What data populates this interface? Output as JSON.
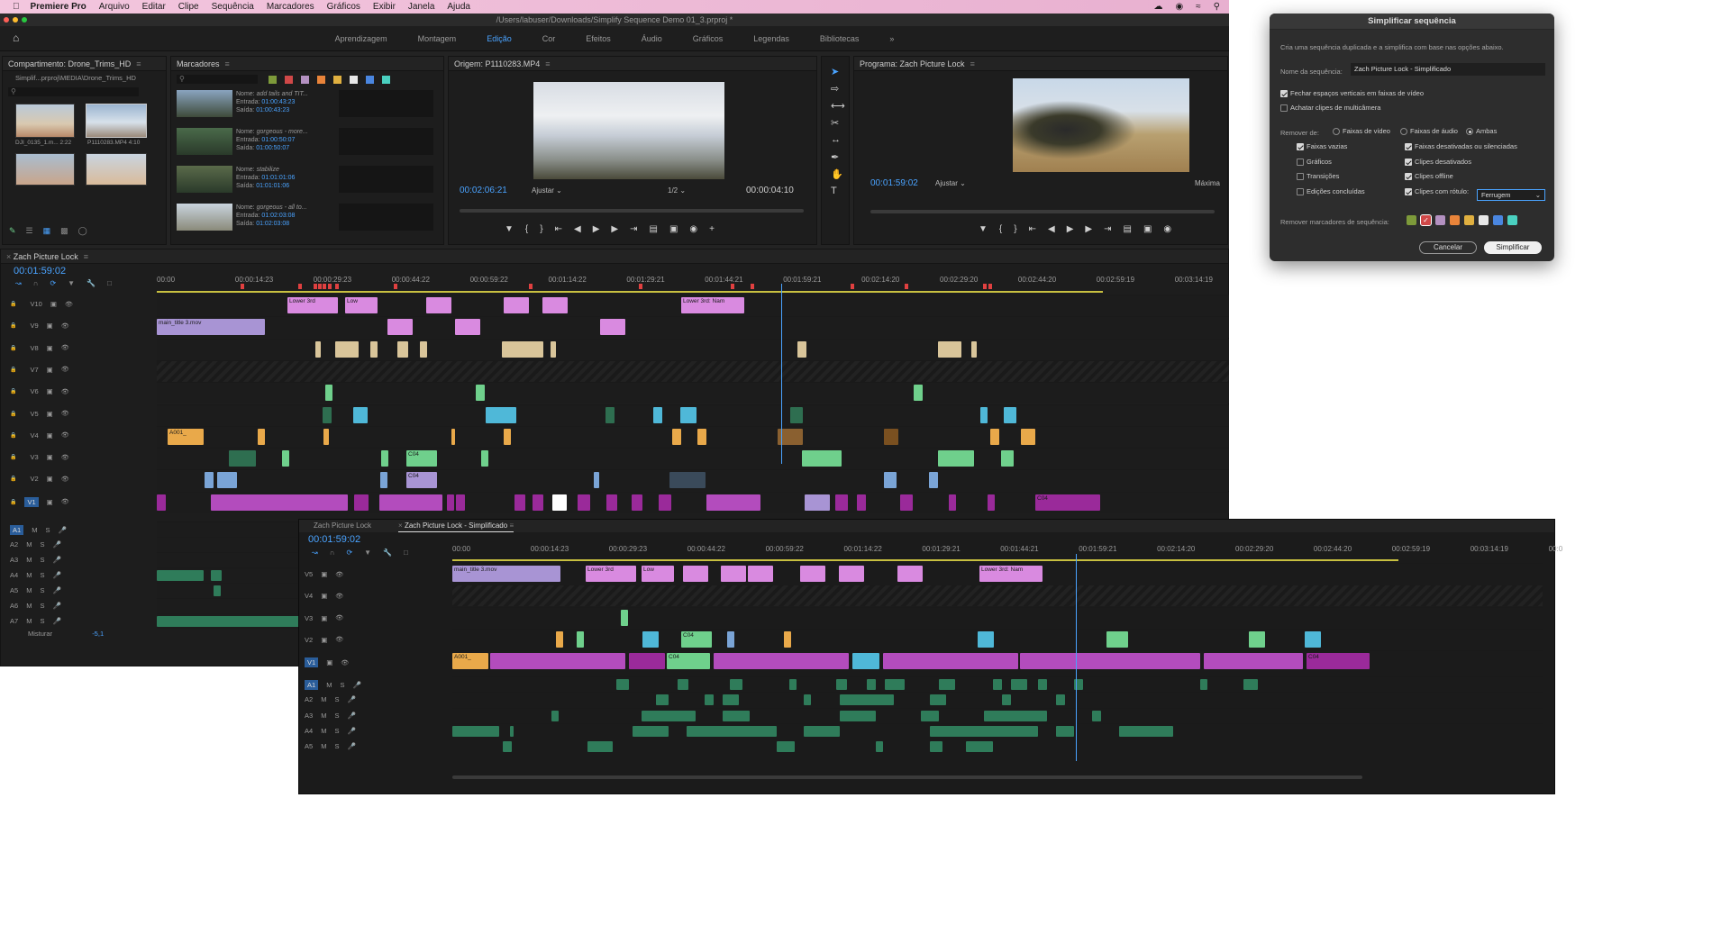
{
  "menubar": {
    "app": "Premiere Pro",
    "items": [
      "Arquivo",
      "Editar",
      "Clipe",
      "Sequência",
      "Marcadores",
      "Gráficos",
      "Exibir",
      "Janela",
      "Ajuda"
    ]
  },
  "window": {
    "title": "/Users/labuser/Downloads/Simplify Sequence Demo 01_3.prproj *"
  },
  "workspaces": [
    "Aprendizagem",
    "Montagem",
    "Edição",
    "Cor",
    "Efeitos",
    "Áudio",
    "Gráficos",
    "Legendas",
    "Bibliotecas"
  ],
  "workspace_more": "»",
  "bin": {
    "title": "Compartimento: Drone_Trims_HD",
    "path": "Simplif...prproj\\MEDIA\\Drone_Trims_HD",
    "items": [
      {
        "name": "DJI_0135_1.m...",
        "dur": "2:22"
      },
      {
        "name": "P1110283.MP4",
        "dur": "4:10"
      }
    ]
  },
  "markers": {
    "title": "Marcadores",
    "list": [
      {
        "name": "add tails and TIT...",
        "in": "01:00:43:23",
        "out": "01:00:43:23"
      },
      {
        "name": "gorgeous - more...",
        "in": "01:00:50:07",
        "out": "01:00:50:07"
      },
      {
        "name": "stabilize",
        "in": "01:01:01:06",
        "out": "01:01:01:06"
      },
      {
        "name": "gorgeous - all to...",
        "in": "01:02:03:08",
        "out": "01:02:03:08"
      }
    ],
    "lbl_name": "Nome:",
    "lbl_in": "Entrada:",
    "lbl_out": "Saída:"
  },
  "source": {
    "title": "Origem: P1110283.MP4",
    "tc_in": "00:02:06:21",
    "fit": "Ajustar",
    "res": "1/2",
    "tc_dur": "00:00:04:10"
  },
  "program": {
    "title": "Programa: Zach Picture Lock",
    "tc": "00:01:59:02",
    "fit": "Ajustar",
    "quality": "Máxima"
  },
  "timeline1": {
    "tab": "Zach Picture Lock",
    "tc": "00:01:59:02",
    "ruler": [
      "00:00",
      "00:00:14:23",
      "00:00:29:23",
      "00:00:44:22",
      "00:00:59:22",
      "00:01:14:22",
      "00:01:29:21",
      "00:01:44:21",
      "00:01:59:21",
      "00:02:14:20",
      "00:02:29:20",
      "00:02:44:20",
      "00:02:59:19",
      "00:03:14:19"
    ],
    "vtracks": [
      "V10",
      "V9",
      "V8",
      "V7",
      "V6",
      "V5",
      "V4",
      "V3",
      "V2",
      "V1"
    ],
    "atracks": [
      "A1",
      "A2",
      "A3",
      "A4",
      "A5",
      "A6",
      "A7"
    ],
    "mix_label": "Misturar",
    "mix_value": "-5,1",
    "clip_labels": {
      "lower": "Lower 3rd",
      "low": "Low",
      "main": "main_title 3.mov",
      "lower_name": "Lower 3rd: Nam",
      "a001": "A001_",
      "c04": "C04"
    }
  },
  "timeline2": {
    "tabs": [
      "Zach Picture Lock",
      "Zach Picture Lock - Simplificado"
    ],
    "tc": "00:01:59:02",
    "ruler": [
      "00:00",
      "00:00:14:23",
      "00:00:29:23",
      "00:00:44:22",
      "00:00:59:22",
      "00:01:14:22",
      "00:01:29:21",
      "00:01:44:21",
      "00:01:59:21",
      "00:02:14:20",
      "00:02:29:20",
      "00:02:44:20",
      "00:02:59:19",
      "00:03:14:19",
      "00:0"
    ],
    "vtracks": [
      "V5",
      "V4",
      "V3",
      "V2",
      "V1"
    ],
    "atracks": [
      "A1",
      "A2",
      "A3",
      "A4",
      "A5"
    ]
  },
  "dialog": {
    "title": "Simplificar sequência",
    "desc": "Cria uma sequência duplicada e a simplifica com base nas opções abaixo.",
    "name_label": "Nome da sequência:",
    "name_value": "Zach Picture Lock - Simplificado",
    "close_gaps": "Fechar espaços verticais em faixas de vídeo",
    "flatten": "Achatar clipes de multicâmera",
    "remove_from": "Remover de:",
    "radio": [
      "Faixas de vídeo",
      "Faixas de áudio",
      "Ambas"
    ],
    "checks": [
      {
        "label": "Faixas vazias",
        "on": true
      },
      {
        "label": "Faixas desativadas ou silenciadas",
        "on": true
      },
      {
        "label": "Gráficos",
        "on": false
      },
      {
        "label": "Clipes desativados",
        "on": true
      },
      {
        "label": "Transições",
        "on": false
      },
      {
        "label": "Clipes offline",
        "on": true
      },
      {
        "label": "Edições concluídas",
        "on": false
      },
      {
        "label": "Clipes com rótulo:",
        "on": true
      }
    ],
    "label_select": "Ferrugem",
    "remove_markers": "Remover marcadores de sequência:",
    "marker_colors": [
      "#7d9a3a",
      "#d04848",
      "#b390c0",
      "#e9843a",
      "#e0b040",
      "#e8e8e8",
      "#4a86e0",
      "#4ad0c0"
    ],
    "marker_checked": [
      false,
      true,
      false,
      false,
      false,
      false,
      false,
      false
    ],
    "cancel": "Cancelar",
    "ok": "Simplificar"
  }
}
